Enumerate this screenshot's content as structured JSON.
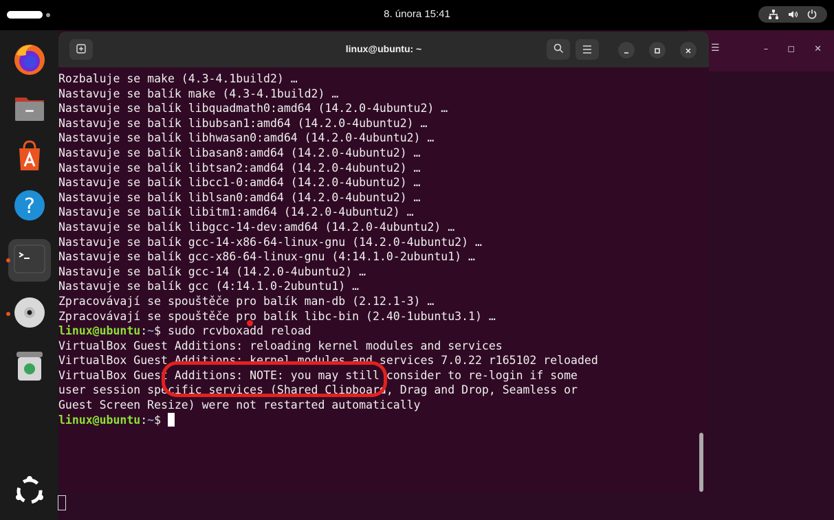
{
  "topbar": {
    "clock": "8. února 15:41",
    "tray_icons": [
      "network-icon",
      "volume-icon",
      "power-icon"
    ]
  },
  "dock": {
    "items": [
      {
        "name": "firefox-icon",
        "running": false
      },
      {
        "name": "files-icon",
        "running": false
      },
      {
        "name": "app-center-icon",
        "running": false
      },
      {
        "name": "help-icon",
        "running": false
      },
      {
        "name": "terminal-icon",
        "running": true
      },
      {
        "name": "disc-icon",
        "running": true
      },
      {
        "name": "trash-icon",
        "running": false
      }
    ],
    "show_apps_icon": "ubuntu-logo-icon"
  },
  "terminal": {
    "title": "linux@ubuntu: ~",
    "lines": [
      "Rozbaluje se make (4.3-4.1build2) …",
      "Nastavuje se balík make (4.3-4.1build2) …",
      "Nastavuje se balík libquadmath0:amd64 (14.2.0-4ubuntu2) …",
      "Nastavuje se balík libubsan1:amd64 (14.2.0-4ubuntu2) …",
      "Nastavuje se balík libhwasan0:amd64 (14.2.0-4ubuntu2) …",
      "Nastavuje se balík libasan8:amd64 (14.2.0-4ubuntu2) …",
      "Nastavuje se balík libtsan2:amd64 (14.2.0-4ubuntu2) …",
      "Nastavuje se balík libcc1-0:amd64 (14.2.0-4ubuntu2) …",
      "Nastavuje se balík liblsan0:amd64 (14.2.0-4ubuntu2) …",
      "Nastavuje se balík libitm1:amd64 (14.2.0-4ubuntu2) …",
      "Nastavuje se balík libgcc-14-dev:amd64 (14.2.0-4ubuntu2) …",
      "Nastavuje se balík gcc-14-x86-64-linux-gnu (14.2.0-4ubuntu2) …",
      "Nastavuje se balík gcc-x86-64-linux-gnu (4:14.1.0-2ubuntu1) …",
      "Nastavuje se balík gcc-14 (14.2.0-4ubuntu2) …",
      "Nastavuje se balík gcc (4:14.1.0-2ubuntu1) …",
      "Zpracovávají se spouštěče pro balík man-db (2.12.1-3) …",
      "Zpracovávají se spouštěče pro balík libc-bin (2.40-1ubuntu3.1) …"
    ],
    "prompt_user": "linux@ubuntu",
    "prompt_sep": ":",
    "prompt_path": "~",
    "prompt_dollar": "$ ",
    "command": "sudo rcvboxadd reload",
    "output_lines": [
      "VirtualBox Guest Additions: reloading kernel modules and services",
      "VirtualBox Guest Additions: kernel modules and services 7.0.22 r165102 reloaded",
      "VirtualBox Guest Additions: NOTE: you may still consider to re-login if some",
      "user session specific services (Shared Clipboard, Drag and Drop, Seamless or",
      "Guest Screen Resize) were not restarted automatically"
    ],
    "prompt_dollar_final": "$ "
  },
  "colors": {
    "terminal_bg": "#300a24",
    "prompt_user": "#8ae234",
    "prompt_path": "#729fcf",
    "annotation": "#e4211f"
  }
}
